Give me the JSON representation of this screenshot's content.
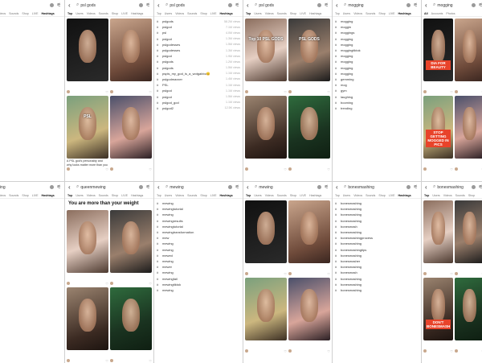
{
  "panels": [
    {
      "query": "",
      "type": "hashtags",
      "crop": true,
      "tabs": [
        "Top",
        "Users",
        "Videos",
        "Sounds",
        "Shop",
        "LIVE",
        "Hashtags"
      ],
      "active_tab": "Hashtags",
      "hashtags": [
        {
          "tag": "",
          "views": ""
        },
        {
          "tag": "og",
          "views": ""
        },
        {
          "tag": "",
          "views": ""
        },
        {
          "tag": "",
          "views": ""
        },
        {
          "tag": "",
          "views": ""
        },
        {
          "tag": "",
          "views": ""
        },
        {
          "tag": "",
          "views": ""
        },
        {
          "tag": "",
          "views": ""
        },
        {
          "tag": "",
          "views": ""
        },
        {
          "tag": "",
          "views": ""
        },
        {
          "tag": "",
          "views": ""
        },
        {
          "tag": "",
          "views": ""
        },
        {
          "tag": "",
          "views": ""
        },
        {
          "tag": "",
          "views": ""
        },
        {
          "tag": "",
          "views": ""
        },
        {
          "tag": "",
          "views": ""
        },
        {
          "tag": "",
          "views": ""
        },
        {
          "tag": "",
          "views": ""
        },
        {
          "tag": "",
          "views": ""
        },
        {
          "tag": "",
          "views": ""
        },
        {
          "tag": "",
          "views": ""
        },
        {
          "tag": "",
          "views": ""
        },
        {
          "tag": "",
          "views": ""
        },
        {
          "tag": "s",
          "views": ""
        }
      ]
    },
    {
      "query": "psl gods",
      "type": "videos",
      "tabs": [
        "Top",
        "Users",
        "Videos",
        "Sounds",
        "Shop",
        "LIVE",
        "Hashtags"
      ],
      "active_tab": "Top",
      "videos": [
        {
          "overlay": "",
          "caption": "",
          "user": "",
          "likes": ""
        },
        {
          "overlay": "",
          "caption": "",
          "user": "",
          "likes": ""
        },
        {
          "overlay": "PSL",
          "caption": "A PSL god's personality and why looks matter more than you think",
          "user": "",
          "likes": ""
        },
        {
          "overlay": "",
          "caption": "",
          "user": "",
          "likes": ""
        }
      ]
    },
    {
      "query": "psl gods",
      "type": "hashtags",
      "tabs": [
        "Top",
        "Users",
        "Videos",
        "Sounds",
        "Shop",
        "LIVE",
        "Hashtags"
      ],
      "active_tab": "Hashtags",
      "hashtags": [
        {
          "tag": "pslgods",
          "views": "58.2M views"
        },
        {
          "tag": "pslgod",
          "views": "7.1M views"
        },
        {
          "tag": "psl",
          "views": "4.0M views"
        },
        {
          "tag": "pslgod",
          "views": "1.3M views"
        },
        {
          "tag": "pslgodesses",
          "views": "1.5M views"
        },
        {
          "tag": "pslgodesses",
          "views": "1.3M views"
        },
        {
          "tag": "pslgod",
          "views": "1.9M views"
        },
        {
          "tag": "pslgods",
          "views": "1.2M views"
        },
        {
          "tag": "pslgods",
          "views": "1.5M views"
        },
        {
          "tag": "pspls_my_god_is_a_wotgabbo😊",
          "views": "1.1M views"
        },
        {
          "tag": "pslgodmaxxer",
          "views": "1.4M views"
        },
        {
          "tag": "PSL",
          "views": "1.1M views"
        },
        {
          "tag": "pslgod",
          "views": "1.1M views"
        },
        {
          "tag": "pslgod",
          "views": "1.5M views"
        },
        {
          "tag": "pslgod_god",
          "views": "1.1M views"
        },
        {
          "tag": "pslgod2",
          "views": "12.5K views"
        }
      ]
    },
    {
      "query": "psl gods",
      "type": "videos",
      "tabs": [
        "Top",
        "Users",
        "Videos",
        "Sounds",
        "Shop",
        "LIVE",
        "Hashtags"
      ],
      "active_tab": "Top",
      "videos": [
        {
          "overlay": "Top 10 PSL GODS",
          "caption": "",
          "user": "",
          "likes": ""
        },
        {
          "overlay": "PSL GODS",
          "caption": "",
          "user": "",
          "likes": ""
        },
        {
          "overlay": "",
          "caption": "",
          "user": "",
          "likes": ""
        },
        {
          "overlay": "",
          "caption": "",
          "user": "",
          "likes": ""
        }
      ]
    },
    {
      "query": "mogging",
      "type": "hashtags",
      "tabs": [
        "Top",
        "Users",
        "Videos",
        "Sounds",
        "Shop",
        "LIVE",
        "Hashtags"
      ],
      "active_tab": "Hashtags",
      "hashtags": [
        {
          "tag": "mogging",
          "views": ""
        },
        {
          "tag": "moggin",
          "views": ""
        },
        {
          "tag": "moggings",
          "views": ""
        },
        {
          "tag": "mogging",
          "views": ""
        },
        {
          "tag": "mogging",
          "views": ""
        },
        {
          "tag": "moggingtiktok",
          "views": ""
        },
        {
          "tag": "mogging",
          "views": ""
        },
        {
          "tag": "mogging",
          "views": ""
        },
        {
          "tag": "mogging",
          "views": ""
        },
        {
          "tag": "mogging",
          "views": ""
        },
        {
          "tag": "gemming",
          "views": ""
        },
        {
          "tag": "mog",
          "views": ""
        },
        {
          "tag": "gym",
          "views": ""
        },
        {
          "tag": "laughing",
          "views": ""
        },
        {
          "tag": "booming",
          "views": ""
        },
        {
          "tag": "trending",
          "views": ""
        }
      ]
    },
    {
      "query": "mogging",
      "type": "videos",
      "crop_right": true,
      "tabs": [
        "All",
        "Accounts",
        "Photos"
      ],
      "active_tab": "All",
      "videos": [
        {
          "overlay": "DIA FOR BEAUTY",
          "caption": "",
          "user": "",
          "likes": ""
        },
        {
          "overlay": "",
          "caption": "",
          "user": "",
          "likes": ""
        },
        {
          "overlay": "STOP GETTING MOGGED IN PICS",
          "caption": "",
          "user": "",
          "likes": ""
        },
        {
          "overlay": "",
          "caption": "",
          "user": "",
          "likes": ""
        }
      ]
    },
    {
      "query": "mewing",
      "type": "hashtags",
      "crop": true,
      "tabs": [
        "Top",
        "Users",
        "Videos",
        "Sounds",
        "Shop",
        "LIVE",
        "Hashtags"
      ],
      "active_tab": "Hashtags",
      "hashtags": [
        {
          "tag": "",
          "views": ""
        },
        {
          "tag": "",
          "views": ""
        },
        {
          "tag": "",
          "views": ""
        },
        {
          "tag": "",
          "views": ""
        },
        {
          "tag": "",
          "views": ""
        },
        {
          "tag": "",
          "views": ""
        },
        {
          "tag": "",
          "views": ""
        },
        {
          "tag": "",
          "views": ""
        },
        {
          "tag": "",
          "views": ""
        },
        {
          "tag": "",
          "views": ""
        },
        {
          "tag": "",
          "views": ""
        },
        {
          "tag": "",
          "views": ""
        },
        {
          "tag": "",
          "views": ""
        },
        {
          "tag": "",
          "views": ""
        },
        {
          "tag": "",
          "views": ""
        },
        {
          "tag": "",
          "views": ""
        },
        {
          "tag": "",
          "views": ""
        },
        {
          "tag": "",
          "views": ""
        },
        {
          "tag": "",
          "views": ""
        },
        {
          "tag": "",
          "views": ""
        },
        {
          "tag": "",
          "views": ""
        },
        {
          "tag": "",
          "views": ""
        },
        {
          "tag": "",
          "views": ""
        },
        {
          "tag": "",
          "views": ""
        }
      ]
    },
    {
      "query": "queenmewing",
      "type": "promo",
      "tabs": [
        "Top",
        "Users",
        "Videos",
        "Sounds",
        "Shop",
        "LIVE",
        "Hashtags"
      ],
      "active_tab": "Top",
      "promo_title": "You are more than your weight",
      "promo_sub": "",
      "videos": [
        {
          "overlay": "",
          "caption": "",
          "user": "",
          "likes": ""
        },
        {
          "overlay": "",
          "caption": "",
          "user": "",
          "likes": ""
        },
        {
          "overlay": "",
          "caption": "",
          "user": "",
          "likes": ""
        },
        {
          "overlay": "",
          "caption": "",
          "user": "",
          "likes": ""
        }
      ]
    },
    {
      "query": "mewing",
      "type": "hashtags",
      "tabs": [
        "Top",
        "Users",
        "Videos",
        "Sounds",
        "Shop",
        "LIVE",
        "Hashtags"
      ],
      "active_tab": "Hashtags",
      "hashtags": [
        {
          "tag": "mewing",
          "views": ""
        },
        {
          "tag": "mewingtutorial",
          "views": ""
        },
        {
          "tag": "mewing",
          "views": ""
        },
        {
          "tag": "mewingresults",
          "views": ""
        },
        {
          "tag": "mewingtutorial",
          "views": ""
        },
        {
          "tag": "mewingtransformation",
          "views": ""
        },
        {
          "tag": "mew",
          "views": ""
        },
        {
          "tag": "mewing",
          "views": ""
        },
        {
          "tag": "mewing",
          "views": ""
        },
        {
          "tag": "mewed",
          "views": ""
        },
        {
          "tag": "mewing",
          "views": ""
        },
        {
          "tag": "mewer",
          "views": ""
        },
        {
          "tag": "mewing",
          "views": ""
        },
        {
          "tag": "mewingfail",
          "views": ""
        },
        {
          "tag": "mewingtiktok",
          "views": ""
        },
        {
          "tag": "mewing",
          "views": ""
        }
      ]
    },
    {
      "query": "mewing",
      "type": "videos",
      "tabs": [
        "Top",
        "Users",
        "Videos",
        "Sounds",
        "Shop",
        "LIVE",
        "Hashtags"
      ],
      "active_tab": "Top",
      "videos": [
        {
          "overlay": "",
          "caption": "",
          "user": "",
          "likes": ""
        },
        {
          "overlay": "",
          "caption": "",
          "user": "",
          "likes": ""
        },
        {
          "overlay": "",
          "caption": "",
          "user": "",
          "likes": ""
        },
        {
          "overlay": "",
          "caption": "",
          "user": "",
          "likes": ""
        }
      ]
    },
    {
      "query": "bonesmashing",
      "type": "hashtags",
      "tabs": [
        "Top",
        "Users",
        "Videos",
        "Sounds",
        "Shop",
        "LIVE",
        "Hashtags"
      ],
      "active_tab": "Hashtags",
      "hashtags": [
        {
          "tag": "bonesmashing",
          "views": ""
        },
        {
          "tag": "bonesmashing",
          "views": ""
        },
        {
          "tag": "bonesmashing",
          "views": ""
        },
        {
          "tag": "bonesmashing",
          "views": ""
        },
        {
          "tag": "bonesmash",
          "views": ""
        },
        {
          "tag": "bonesmashing",
          "views": ""
        },
        {
          "tag": "bonesmashingprocess",
          "views": ""
        },
        {
          "tag": "bonesmashing",
          "views": ""
        },
        {
          "tag": "bonesmashingtips",
          "views": ""
        },
        {
          "tag": "bonesmashing",
          "views": ""
        },
        {
          "tag": "bonesmasher",
          "views": ""
        },
        {
          "tag": "bonesmashing",
          "views": ""
        },
        {
          "tag": "bonesmash",
          "views": ""
        },
        {
          "tag": "bonesmashing",
          "views": ""
        },
        {
          "tag": "bonesmashing",
          "views": ""
        },
        {
          "tag": "bonesmashing",
          "views": ""
        }
      ]
    },
    {
      "query": "bonesmashing",
      "type": "videos",
      "crop_right": true,
      "tabs": [
        "Top",
        "Users",
        "Videos",
        "Sounds",
        "Shop"
      ],
      "active_tab": "Top",
      "videos": [
        {
          "overlay": "",
          "caption": "",
          "user": "",
          "likes": ""
        },
        {
          "overlay": "",
          "caption": "",
          "user": "",
          "likes": ""
        },
        {
          "overlay": "DON'T BONESMASH",
          "caption": "",
          "user": "",
          "likes": ""
        },
        {
          "overlay": "",
          "caption": "",
          "user": "",
          "likes": ""
        }
      ]
    }
  ]
}
